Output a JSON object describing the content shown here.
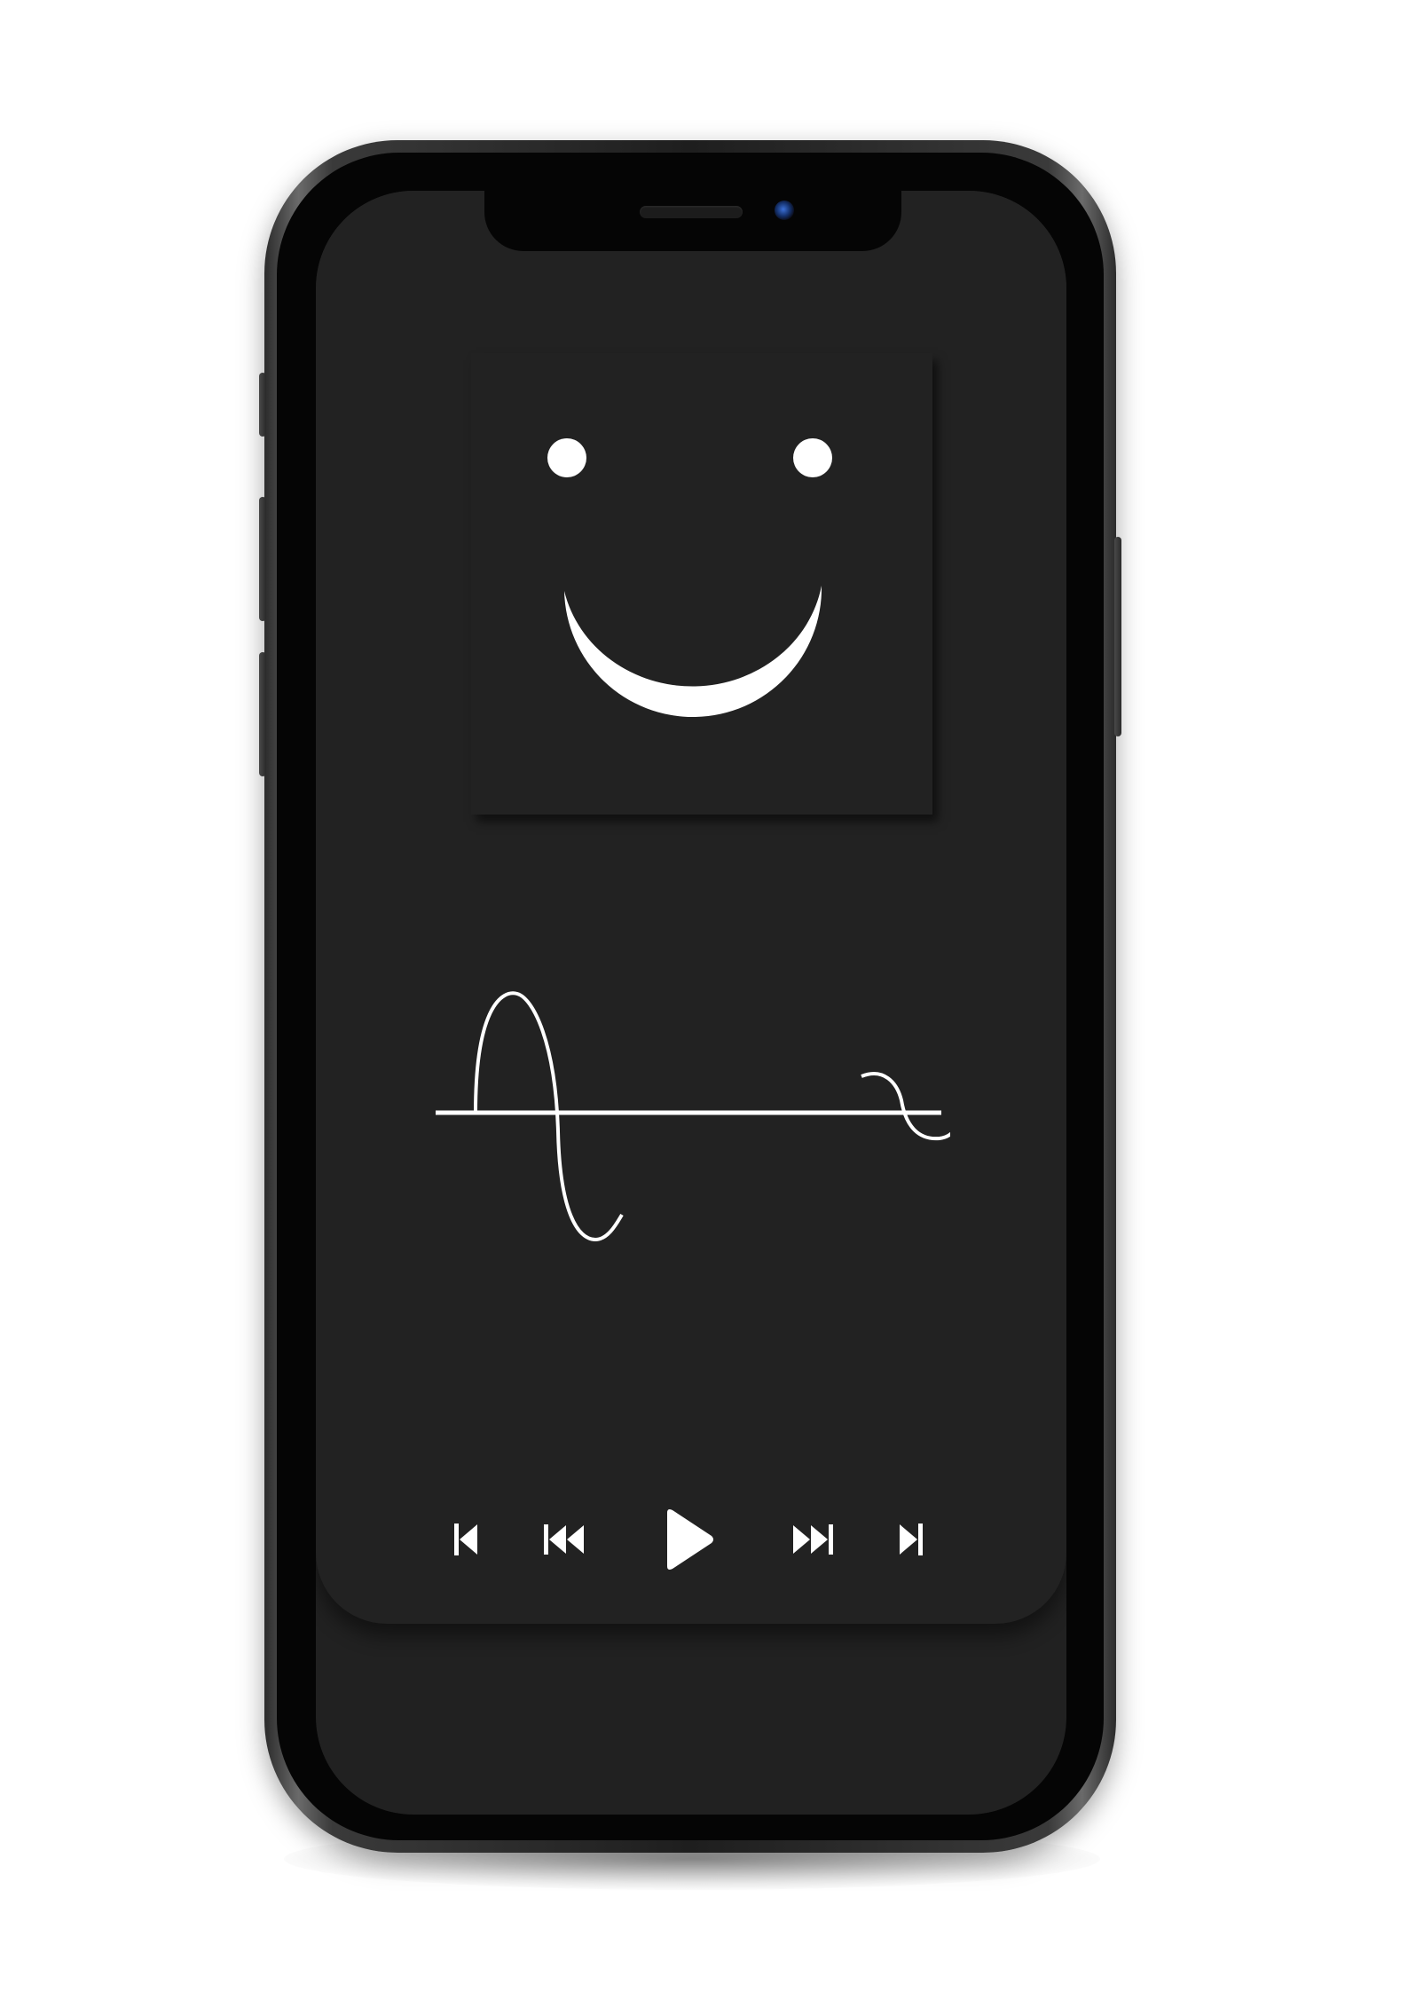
{
  "app": {
    "screen": "music-player"
  },
  "colors": {
    "page_background": "#ffffff",
    "screen_background": "#212121",
    "foreground": "#ffffff",
    "frame": "#1e1e1e"
  },
  "artwork": {
    "icon": "smiley-face"
  },
  "waveform": {
    "icon": "sine-wave"
  },
  "controls": [
    {
      "icon": "skip-to-start-icon"
    },
    {
      "icon": "rewind-icon"
    },
    {
      "icon": "play-icon"
    },
    {
      "icon": "fast-forward-icon"
    },
    {
      "icon": "skip-to-end-icon"
    }
  ]
}
